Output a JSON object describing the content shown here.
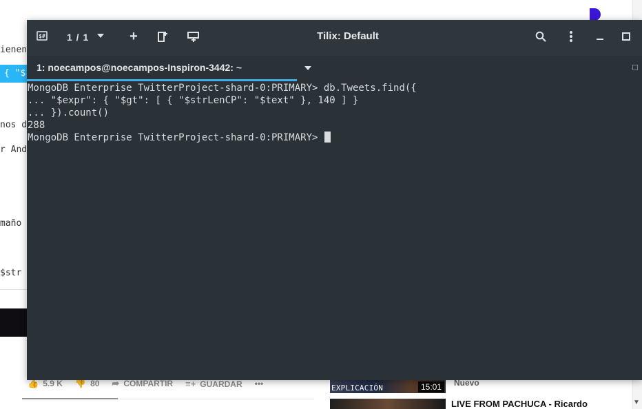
{
  "background": {
    "fragments": [
      "ienen",
      "{ \"$",
      "nos d",
      "r And",
      "maño",
      " $str"
    ],
    "actions": {
      "likes": "5.9 K",
      "dislikes": "80",
      "share": "COMPARTIR",
      "save": "GUARDAR",
      "more": "•••"
    },
    "video1": {
      "caption": "EXPLICACIÓN",
      "duration": "15:01",
      "badge": "Nuevo"
    },
    "video2": {
      "title": "LIVE FROM PACHUCA - Ricardo"
    }
  },
  "window": {
    "title": "Tilix: Default",
    "session_counter": "1 / 1",
    "terminal_icon_text": "$#",
    "tab_label": "1: noecampos@noecampos-Inspiron-3442: ~",
    "accent": "#3daee9",
    "bg": "#2b3237"
  },
  "terminal": {
    "lines": [
      "MongoDB Enterprise TwitterProject-shard-0:PRIMARY> db.Tweets.find({",
      "... \"$expr\": { \"$gt\": [ { \"$strLenCP\": \"$text\" }, 140 ] }",
      "... }).count()",
      "288"
    ],
    "prompt": "MongoDB Enterprise TwitterProject-shard-0:PRIMARY> "
  },
  "icons": {
    "terminal": "terminal-icon",
    "add": "plus-icon",
    "split_h": "split-horizontal-icon",
    "split_v": "split-vertical-icon",
    "search": "search-icon",
    "menu": "kebab-menu-icon",
    "minimize": "minimize-icon",
    "maximize": "maximize-icon"
  }
}
